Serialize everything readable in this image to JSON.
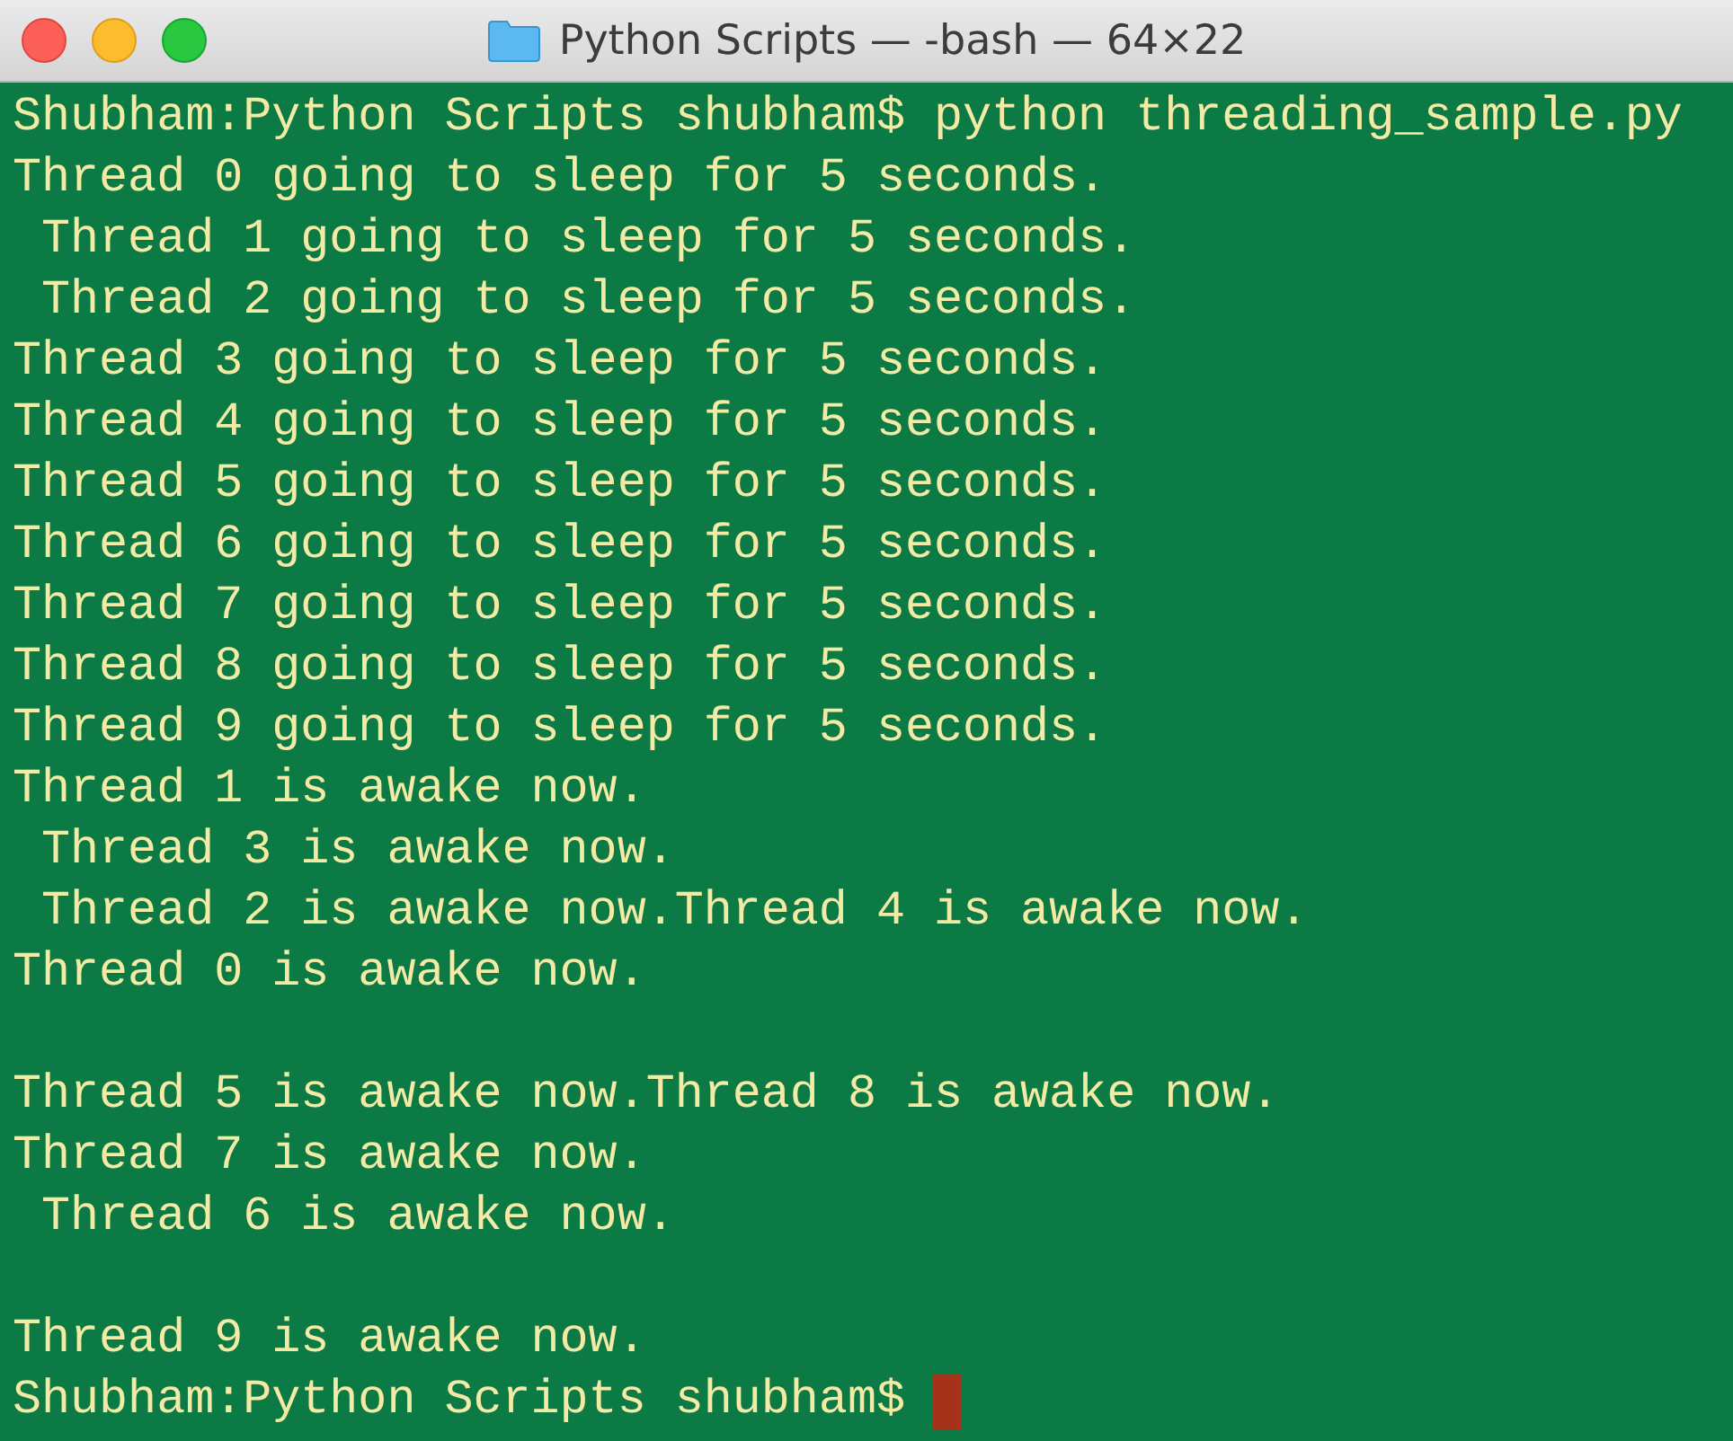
{
  "window": {
    "title": "Python Scripts — -bash — 64×22"
  },
  "lines": [
    {
      "kind": "prompt",
      "prompt": "Shubham:Python Scripts shubham$",
      "command": "python threading_sample.py",
      "cursor": false
    },
    {
      "kind": "output",
      "text": "Thread 0 going to sleep for 5 seconds."
    },
    {
      "kind": "output",
      "text": " Thread 1 going to sleep for 5 seconds."
    },
    {
      "kind": "output",
      "text": " Thread 2 going to sleep for 5 seconds."
    },
    {
      "kind": "output",
      "text": "Thread 3 going to sleep for 5 seconds."
    },
    {
      "kind": "output",
      "text": "Thread 4 going to sleep for 5 seconds."
    },
    {
      "kind": "output",
      "text": "Thread 5 going to sleep for 5 seconds."
    },
    {
      "kind": "output",
      "text": "Thread 6 going to sleep for 5 seconds."
    },
    {
      "kind": "output",
      "text": "Thread 7 going to sleep for 5 seconds."
    },
    {
      "kind": "output",
      "text": "Thread 8 going to sleep for 5 seconds."
    },
    {
      "kind": "output",
      "text": "Thread 9 going to sleep for 5 seconds."
    },
    {
      "kind": "output",
      "text": "Thread 1 is awake now."
    },
    {
      "kind": "output",
      "text": " Thread 3 is awake now."
    },
    {
      "kind": "output",
      "text": " Thread 2 is awake now.Thread 4 is awake now."
    },
    {
      "kind": "output",
      "text": "Thread 0 is awake now."
    },
    {
      "kind": "blank"
    },
    {
      "kind": "output",
      "text": "Thread 5 is awake now.Thread 8 is awake now."
    },
    {
      "kind": "output",
      "text": "Thread 7 is awake now."
    },
    {
      "kind": "output",
      "text": " Thread 6 is awake now."
    },
    {
      "kind": "blank"
    },
    {
      "kind": "output",
      "text": "Thread 9 is awake now."
    },
    {
      "kind": "prompt",
      "prompt": "Shubham:Python Scripts shubham$",
      "cursor": true
    }
  ]
}
